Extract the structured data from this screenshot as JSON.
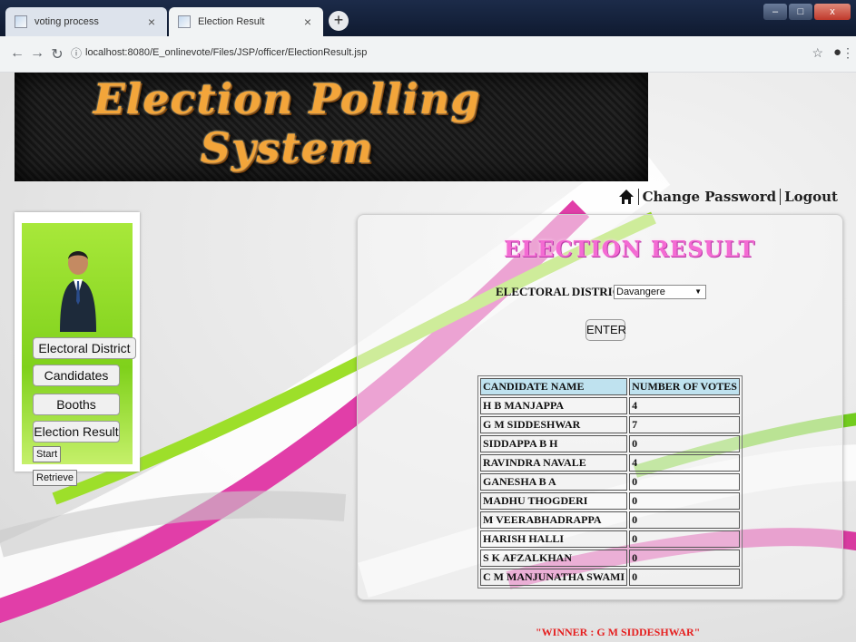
{
  "browser": {
    "tabs": [
      {
        "title": "voting process",
        "active": false
      },
      {
        "title": "Election Result",
        "active": true
      }
    ],
    "url": "localhost:8080/E_onlinevote/Files/JSP/officer/ElectionResult.jsp"
  },
  "icons": {
    "back": "back-arrow-icon",
    "forward": "forward-arrow-icon",
    "reload": "reload-icon",
    "info": "info-icon",
    "star": "star-icon",
    "profile": "profile-icon",
    "menu": "menu-dots-icon",
    "home": "home-icon",
    "avatar": "officer-avatar-icon"
  },
  "banner": {
    "title": "Election Polling System"
  },
  "toplinks": {
    "change_password": "Change Password",
    "logout": "Logout"
  },
  "sidebar": {
    "items": [
      "Electoral District",
      "Candidates",
      "Booths",
      "Election Result"
    ],
    "start": "Start",
    "retrieve": "Retrieve"
  },
  "result": {
    "title": "ELECTION RESULT",
    "district_label": "ELECTORAL DISTRICT",
    "district_colon": ":",
    "district_value": "Davangere",
    "enter_label": "ENTER",
    "table": {
      "headers": [
        "CANDIDATE NAME",
        "NUMBER OF VOTES"
      ],
      "rows": [
        {
          "name": "H B MANJAPPA",
          "votes": "4"
        },
        {
          "name": "G M SIDDESHWAR",
          "votes": "7"
        },
        {
          "name": "SIDDAPPA B H",
          "votes": "0"
        },
        {
          "name": "RAVINDRA NAVALE",
          "votes": "4"
        },
        {
          "name": "GANESHA B A",
          "votes": "0"
        },
        {
          "name": "MADHU THOGDERI",
          "votes": "0"
        },
        {
          "name": "M VEERABHADRAPPA",
          "votes": "0"
        },
        {
          "name": "HARISH HALLI",
          "votes": "0"
        },
        {
          "name": "S K AFZALKHAN",
          "votes": "0"
        },
        {
          "name": "C M MANJUNATHA SWAMI",
          "votes": "0"
        }
      ]
    },
    "winner": "\"WINNER : G M SIDDESHWAR\""
  },
  "colors": {
    "title_pink": "#f46bd3",
    "winner_red": "#e52020",
    "sidebar_green": "#8fdc24",
    "banner_orange": "#f3a53a"
  }
}
